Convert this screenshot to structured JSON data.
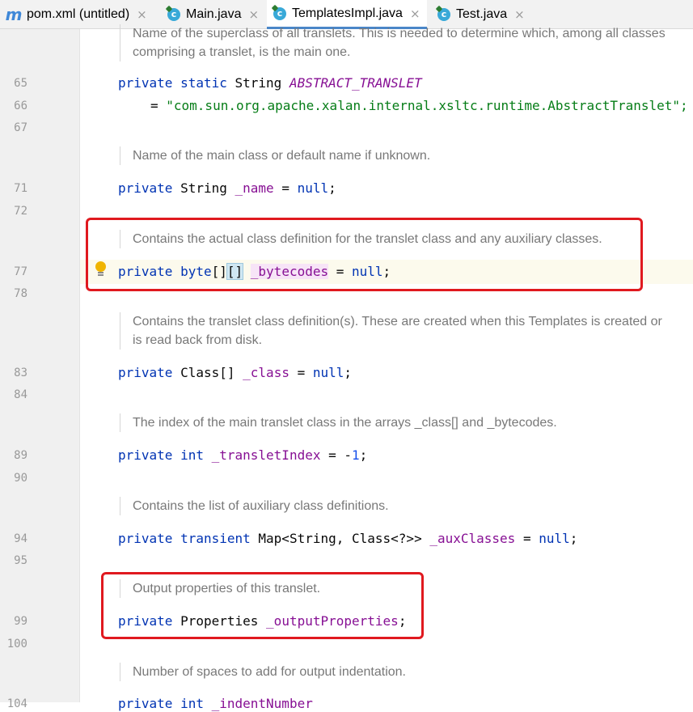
{
  "tabs": [
    {
      "label": "pom.xml (untitled)",
      "icon": "maven-icon",
      "active": false
    },
    {
      "label": "Main.java",
      "icon": "java-class-icon",
      "active": false
    },
    {
      "label": "TemplatesImpl.java",
      "icon": "java-class-icon",
      "active": true
    },
    {
      "label": "Test.java",
      "icon": "java-class-icon",
      "active": false
    }
  ],
  "tab_close_glyph": "×",
  "line_numbers": [
    "65",
    "66",
    "67",
    "71",
    "72",
    "77",
    "78",
    "83",
    "84",
    "89",
    "90",
    "94",
    "95",
    "99",
    "100",
    "104"
  ],
  "docs": {
    "superclass_1": "Name of the superclass of all translets. This is needed to determine which, among all classes",
    "superclass_2": "comprising a translet, is the main one.",
    "name": "Name of the main class or default name if unknown.",
    "bytecodes": "Contains the actual class definition for the translet class and any auxiliary classes.",
    "class_1": "Contains the translet class definition(s). These are created when this Templates is created or",
    "class_2": "is read back from disk.",
    "index": "The index of the main translet class in the arrays _class[] and _bytecodes.",
    "aux": "Contains the list of auxiliary class definitions.",
    "output": "Output properties of this translet.",
    "indent": "Number of spaces to add for output indentation."
  },
  "code": {
    "l65": {
      "kw": "private static",
      "type": "String",
      "name": "ABSTRACT_TRANSLET"
    },
    "l66": {
      "eq": "= ",
      "str": "\"com.sun.org.apache.xalan.internal.xsltc.runtime.AbstractTranslet\";"
    },
    "l71": {
      "kw": "private",
      "type": "String",
      "name": "_name",
      "eq": " = ",
      "val": "null",
      "end": ";"
    },
    "l77": {
      "kw1": "private",
      "kw2": "byte",
      "br1": "[]",
      "br2": "[]",
      "name": "_bytecodes",
      "eq": " = ",
      "val": "null",
      "end": ";"
    },
    "l83": {
      "kw": "private",
      "type": "Class[]",
      "name": "_class",
      "eq": " = ",
      "val": "null",
      "end": ";"
    },
    "l89": {
      "kw": "private int",
      "name": "_transletIndex",
      "eq": " = -",
      "val": "1",
      "end": ";"
    },
    "l94": {
      "kw": "private transient",
      "type": "Map<String, Class<?>>",
      "name": "_auxClasses",
      "eq": " = ",
      "val": "null",
      "end": ";"
    },
    "l99": {
      "kw": "private",
      "type": "Properties",
      "name": "_outputProperties",
      "end": ";"
    },
    "l104": {
      "kw": "private int",
      "name": "_indentNumber"
    }
  },
  "colors": {
    "keyword": "#0033b3",
    "field": "#871094",
    "string": "#067d17",
    "number": "#1750eb",
    "comment": "#787878",
    "highlight_box": "#e0191f"
  }
}
